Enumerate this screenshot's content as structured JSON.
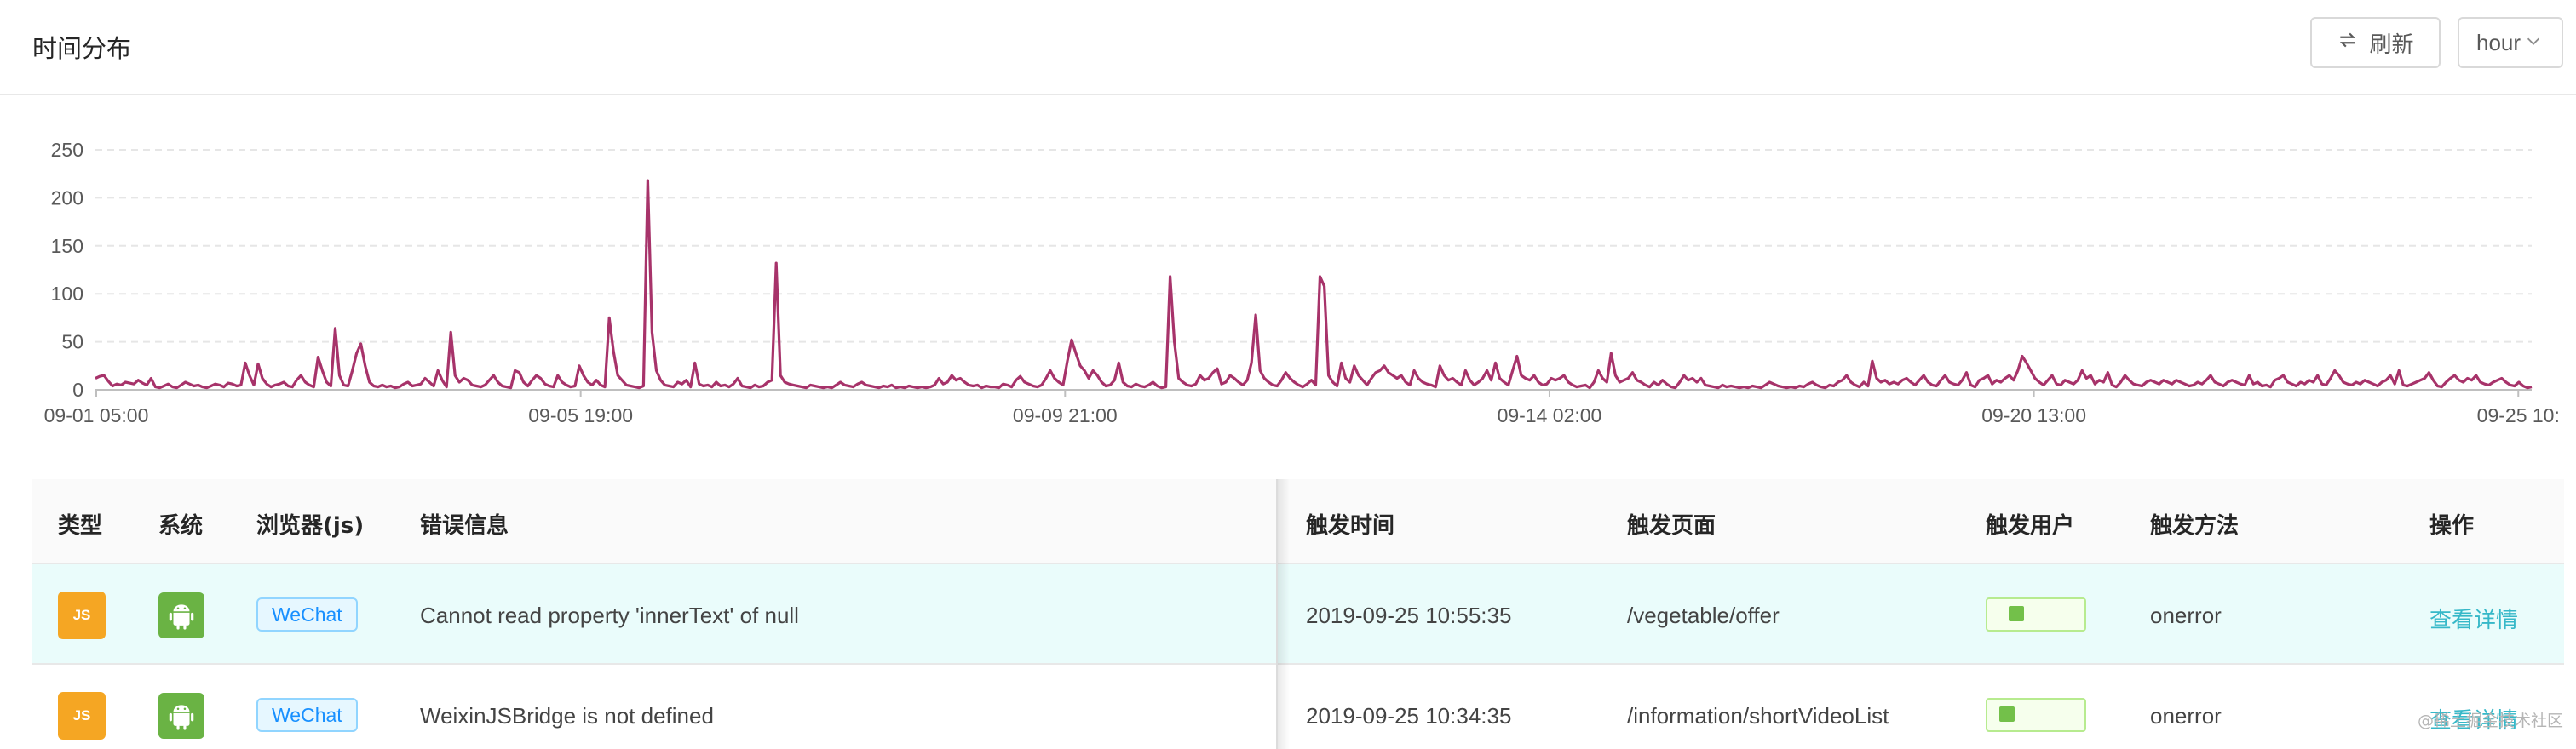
{
  "header": {
    "title": "时间分布",
    "refresh_label": "刷新",
    "range_value": "hour"
  },
  "chart_data": {
    "type": "line",
    "title": "",
    "xlabel": "",
    "ylabel": "",
    "ylim": [
      0,
      250
    ],
    "yticks": [
      0,
      50,
      100,
      150,
      200,
      250
    ],
    "grid": true,
    "legend": "none",
    "color": "#a7336a",
    "xtick_labels": [
      "09-01 05:00",
      "09-05 19:00",
      "09-09 21:00",
      "09-14 02:00",
      "09-20 13:00",
      "09-25 10:"
    ],
    "series": [
      {
        "values": [
          12,
          14,
          15,
          9,
          4,
          6,
          5,
          8,
          7,
          6,
          10,
          7,
          5,
          12,
          3,
          2,
          4,
          6,
          3,
          2,
          5,
          8,
          6,
          4,
          5,
          3,
          2,
          4,
          6,
          5,
          3,
          7,
          6,
          4,
          5,
          28,
          15,
          5,
          27,
          12,
          6,
          3,
          5,
          6,
          8,
          4,
          3,
          10,
          15,
          8,
          5,
          3,
          34,
          20,
          8,
          4,
          64,
          15,
          5,
          4,
          20,
          38,
          48,
          25,
          8,
          4,
          3,
          5,
          3,
          4,
          2,
          3,
          6,
          8,
          4,
          5,
          6,
          12,
          8,
          4,
          20,
          10,
          3,
          60,
          15,
          8,
          12,
          10,
          5,
          4,
          3,
          5,
          10,
          15,
          8,
          4,
          3,
          2,
          20,
          18,
          8,
          4,
          10,
          15,
          12,
          6,
          4,
          3,
          15,
          8,
          5,
          3,
          4,
          25,
          15,
          8,
          5,
          10,
          5,
          3,
          75,
          40,
          15,
          10,
          5,
          4,
          3,
          2,
          4,
          218,
          60,
          20,
          10,
          5,
          4,
          3,
          8,
          6,
          10,
          3,
          28,
          6,
          4,
          5,
          3,
          8,
          4,
          5,
          3,
          6,
          12,
          4,
          3,
          2,
          5,
          3,
          4,
          8,
          10,
          132,
          15,
          8,
          6,
          5,
          4,
          3,
          2,
          5,
          4,
          3,
          2,
          3,
          2,
          5,
          8,
          5,
          4,
          3,
          6,
          8,
          5,
          4,
          3,
          2,
          4,
          3,
          5,
          2,
          3,
          2,
          4,
          3,
          2,
          3,
          2,
          3,
          5,
          12,
          6,
          8,
          15,
          10,
          12,
          8,
          5,
          4,
          5,
          2,
          4,
          3,
          3,
          2,
          6,
          5,
          3,
          10,
          14,
          8,
          6,
          4,
          3,
          5,
          12,
          20,
          12,
          8,
          5,
          30,
          52,
          38,
          25,
          20,
          12,
          20,
          15,
          8,
          4,
          5,
          10,
          28,
          8,
          4,
          3,
          6,
          4,
          3,
          5,
          8,
          4,
          2,
          3,
          118,
          50,
          12,
          8,
          5,
          4,
          6,
          15,
          10,
          12,
          18,
          22,
          6,
          8,
          15,
          12,
          8,
          5,
          10,
          28,
          78,
          20,
          12,
          8,
          5,
          4,
          10,
          18,
          12,
          8,
          5,
          3,
          6,
          10,
          5,
          118,
          108,
          15,
          8,
          4,
          28,
          12,
          8,
          25,
          15,
          10,
          5,
          12,
          18,
          20,
          25,
          18,
          15,
          12,
          15,
          8,
          5,
          20,
          12,
          8,
          6,
          5,
          3,
          25,
          15,
          10,
          12,
          8,
          5,
          20,
          10,
          5,
          8,
          12,
          20,
          10,
          28,
          12,
          8,
          5,
          20,
          35,
          15,
          12,
          10,
          15,
          8,
          5,
          6,
          12,
          10,
          12,
          15,
          8,
          5,
          3,
          4,
          5,
          2,
          8,
          20,
          12,
          8,
          38,
          15,
          8,
          10,
          12,
          18,
          10,
          8,
          5,
          3,
          8,
          5,
          10,
          6,
          3,
          2,
          8,
          15,
          10,
          12,
          8,
          12,
          5,
          4,
          3,
          2,
          5,
          3,
          4,
          3,
          2,
          3,
          2,
          4,
          3,
          2,
          5,
          8,
          6,
          4,
          3,
          2,
          3,
          2,
          4,
          3,
          6,
          8,
          5,
          3,
          2,
          5,
          4,
          8,
          10,
          15,
          8,
          5,
          3,
          8,
          4,
          30,
          12,
          8,
          10,
          6,
          8,
          6,
          10,
          12,
          8,
          5,
          10,
          15,
          8,
          5,
          4,
          10,
          15,
          8,
          6,
          5,
          10,
          18,
          5,
          3,
          10,
          12,
          15,
          6,
          10,
          8,
          12,
          15,
          10,
          20,
          35,
          28,
          20,
          12,
          8,
          5,
          10,
          15,
          6,
          5,
          10,
          8,
          6,
          10,
          20,
          12,
          15,
          6,
          10,
          8,
          18,
          5,
          3,
          8,
          15,
          10,
          6,
          5,
          4,
          8,
          10,
          8,
          6,
          10,
          8,
          6,
          10,
          8,
          6,
          4,
          5,
          8,
          6,
          10,
          15,
          8,
          6,
          4,
          8,
          10,
          8,
          6,
          5,
          15,
          6,
          8,
          4,
          5,
          3,
          10,
          12,
          15,
          8,
          6,
          4,
          8,
          6,
          10,
          8,
          15,
          6,
          5,
          12,
          20,
          15,
          8,
          6,
          5,
          8,
          6,
          10,
          8,
          6,
          4,
          8,
          10,
          15,
          6,
          20,
          5,
          4,
          6,
          8,
          10,
          12,
          18,
          10,
          4,
          3,
          8,
          12,
          15,
          10,
          8,
          12,
          10,
          15,
          8,
          6,
          5,
          8,
          10,
          12,
          8,
          5,
          4,
          8,
          4,
          2,
          3
        ]
      }
    ]
  },
  "table": {
    "headers": {
      "type": "类型",
      "system": "系统",
      "browser": "浏览器(js)",
      "error": "错误信息",
      "time": "触发时间",
      "page": "触发页面",
      "user": "触发用户",
      "method": "触发方法",
      "action": "操作"
    },
    "rows": [
      {
        "type_badge": "JS",
        "system_icon": "android-icon",
        "browser": "WeChat",
        "error": "Cannot read property 'innerText' of null",
        "time": "2019-09-25 10:55:35",
        "page": "/vegetable/offer",
        "user_level": 0.25,
        "method": "onerror",
        "action": "查看详情"
      },
      {
        "type_badge": "JS",
        "system_icon": "android-icon",
        "browser": "WeChat",
        "error": "WeixinJSBridge is not defined",
        "time": "2019-09-25 10:34:35",
        "page": "/information/shortVideoList",
        "user_level": 0.1,
        "method": "onerror",
        "action": "查看详情"
      }
    ]
  },
  "watermark": "@稀土掘金技术社区",
  "colors": {
    "line": "#a7336a",
    "active_row": "#eafcfb",
    "link": "#36b8c8",
    "js_badge": "#f5a623",
    "android_badge": "#6ab344"
  }
}
